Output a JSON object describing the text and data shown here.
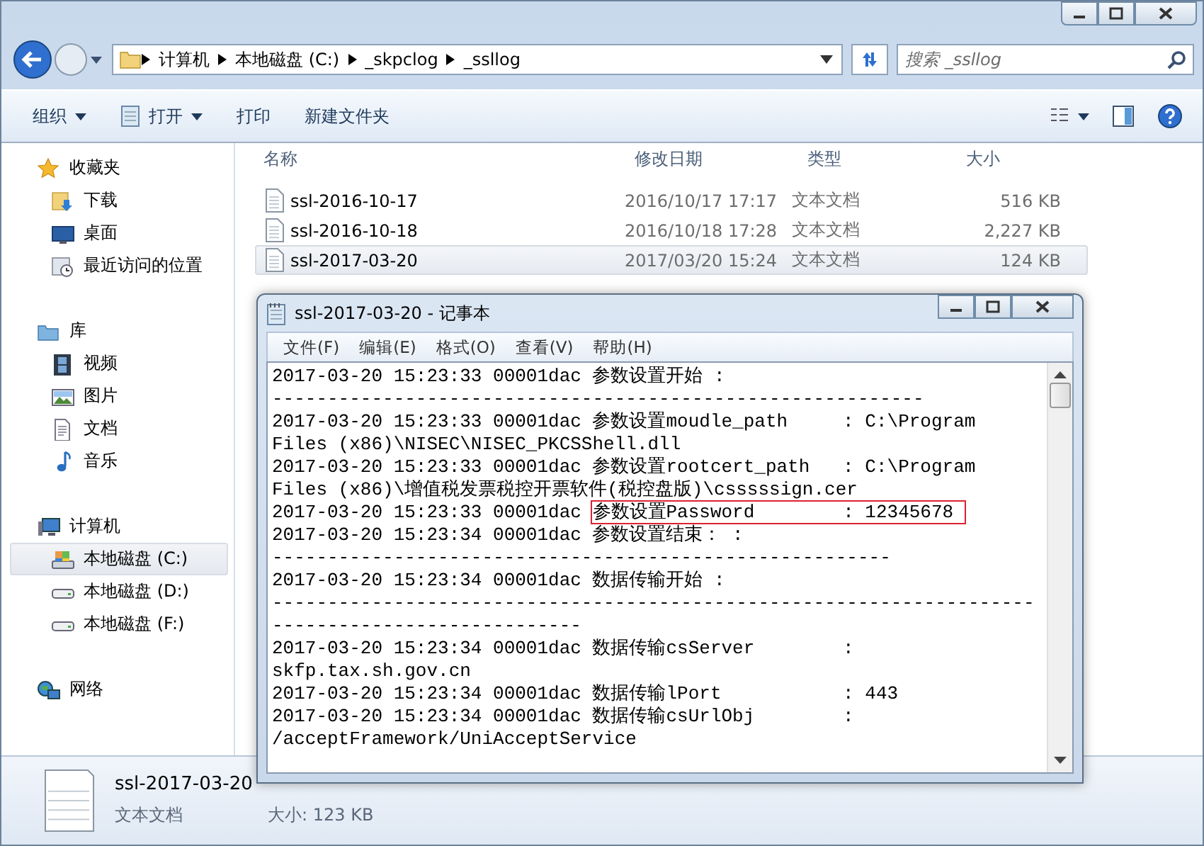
{
  "explorer": {
    "breadcrumb": [
      "计算机",
      "本地磁盘 (C:)",
      "_skpclog",
      "_ssllog"
    ],
    "search": {
      "placeholder": "搜索 _ssllog"
    },
    "toolbar": [
      {
        "label": "组织",
        "kind": "menu"
      },
      {
        "label": "打开",
        "kind": "menu"
      },
      {
        "label": "打印",
        "kind": "plain"
      },
      {
        "label": "新建文件夹",
        "kind": "plain"
      }
    ],
    "sidebar": [
      {
        "label": "收藏夹",
        "selected": false,
        "children": [
          {
            "label": "下载",
            "selected": false
          },
          {
            "label": "桌面",
            "selected": false
          },
          {
            "label": "最近访问的位置",
            "selected": false
          }
        ]
      },
      {
        "label": "库",
        "selected": false,
        "children": [
          {
            "label": "视频",
            "selected": false
          },
          {
            "label": "图片",
            "selected": false
          },
          {
            "label": "文档",
            "selected": false
          },
          {
            "label": "音乐",
            "selected": false
          }
        ]
      },
      {
        "label": "计算机",
        "selected": false,
        "children": [
          {
            "label": "本地磁盘 (C:)",
            "selected": true
          },
          {
            "label": "本地磁盘 (D:)",
            "selected": false
          },
          {
            "label": "本地磁盘 (F:)",
            "selected": false
          }
        ]
      },
      {
        "label": "网络",
        "selected": false
      }
    ],
    "columns": [
      "名称",
      "修改日期",
      "类型",
      "大小"
    ],
    "files": [
      {
        "name": "ssl-2016-10-17",
        "date": "2016/10/17 17:17",
        "type": "文本文档",
        "size": "516 KB",
        "selected": false
      },
      {
        "name": "ssl-2016-10-18",
        "date": "2016/10/18 17:28",
        "type": "文本文档",
        "size": "2,227 KB",
        "selected": false
      },
      {
        "name": "ssl-2017-03-20",
        "date": "2017/03/20 15:24",
        "type": "文本文档",
        "size": "124 KB",
        "selected": true
      }
    ],
    "details": {
      "name": "ssl-2017-03-20",
      "type": "文本文档",
      "size": "大小: 123 KB"
    }
  },
  "notepad": {
    "title": "ssl-2017-03-20 - 记事本",
    "menu": [
      "文件(F)",
      "编辑(E)",
      "格式(O)",
      "查看(V)",
      "帮助(H)"
    ],
    "lines": [
      {
        "text": "2017-03-20 15:23:33 00001dac 参数设置开始 :"
      },
      {
        "text": "-----------------------------------------------------------"
      },
      {
        "text": "2017-03-20 15:23:33 00001dac 参数设置moudle_path     : C:\\Program"
      },
      {
        "text": "Files (x86)\\NISEC\\NISEC_PKCSShell.dll"
      },
      {
        "text": "2017-03-20 15:23:33 00001dac 参数设置rootcert_path   : C:\\Program"
      },
      {
        "text": "Files (x86)\\增值税发票税控开票软件(税控盘版)\\csssssign.cer"
      },
      {
        "text": "2017-03-20 15:23:33 00001dac",
        "highlight": "参数设置Password        : 12345678"
      },
      {
        "text": "2017-03-20 15:23:34 00001dac 参数设置结束： :"
      },
      {
        "text": "--------------------------------------------------------"
      },
      {
        "text": "2017-03-20 15:23:34 00001dac 数据传输开始 :"
      },
      {
        "text": "---------------------------------------------------------------------"
      },
      {
        "text": "----------------------------"
      },
      {
        "text": "2017-03-20 15:23:34 00001dac 数据传输csServer        :"
      },
      {
        "text": "skfp.tax.sh.gov.cn"
      },
      {
        "text": "2017-03-20 15:23:34 00001dac 数据传输lPort           : 443"
      },
      {
        "text": "2017-03-20 15:23:34 00001dac 数据传输csUrlObj        :"
      },
      {
        "text": "/acceptFramework/UniAcceptService"
      }
    ]
  }
}
